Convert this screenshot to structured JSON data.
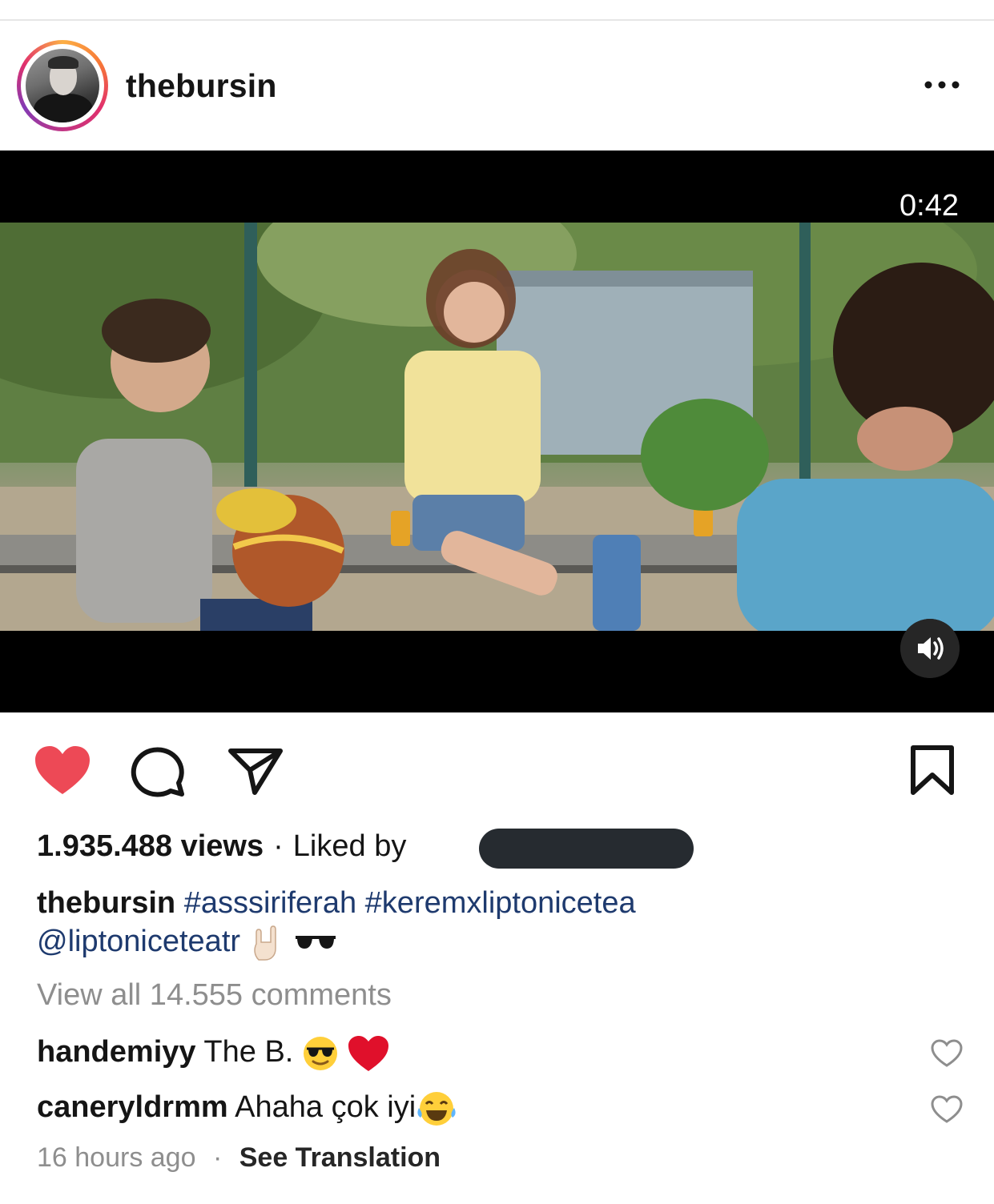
{
  "header": {
    "username": "thebursin"
  },
  "video": {
    "duration": "0:42"
  },
  "stats": {
    "views": "1.935.488 views",
    "separator": "·",
    "liked_by": "Liked by"
  },
  "caption": {
    "user": "thebursin",
    "tag1": "#asssiriferah",
    "tag2": "#keremxliptonicetea",
    "mention": "@liptoniceteatr"
  },
  "comments_link": "View all 14.555 comments",
  "comments": [
    {
      "user": "handemiyy",
      "text": "The B."
    },
    {
      "user": "caneryldrmm",
      "text": "Ahaha çok iyi"
    }
  ],
  "meta": {
    "time": "16 hours ago",
    "separator": "·",
    "see_translation": "See Translation"
  },
  "icons": {
    "like": "heart-filled-icon",
    "comment": "comment-icon",
    "share": "paper-plane-icon",
    "save": "bookmark-icon",
    "more": "more-dots-icon",
    "volume": "speaker-icon"
  },
  "colors": {
    "like_red": "#ed4956",
    "hashtag_blue": "#1e3a6e",
    "muted_gray": "#8e8e8e"
  }
}
